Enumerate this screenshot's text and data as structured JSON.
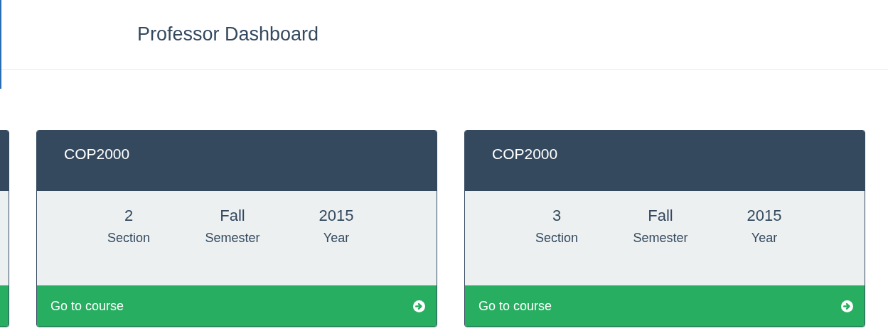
{
  "header": {
    "title": "Professor Dashboard"
  },
  "courses": [
    {
      "code": "COP2000",
      "stats": [
        {
          "value": "2",
          "label": "Section"
        },
        {
          "value": "Fall",
          "label": "Semester"
        },
        {
          "value": "2015",
          "label": "Year"
        }
      ],
      "link": "Go to course"
    },
    {
      "code": "COP2000",
      "stats": [
        {
          "value": "3",
          "label": "Section"
        },
        {
          "value": "Fall",
          "label": "Semester"
        },
        {
          "value": "2015",
          "label": "Year"
        }
      ],
      "link": "Go to course"
    }
  ]
}
